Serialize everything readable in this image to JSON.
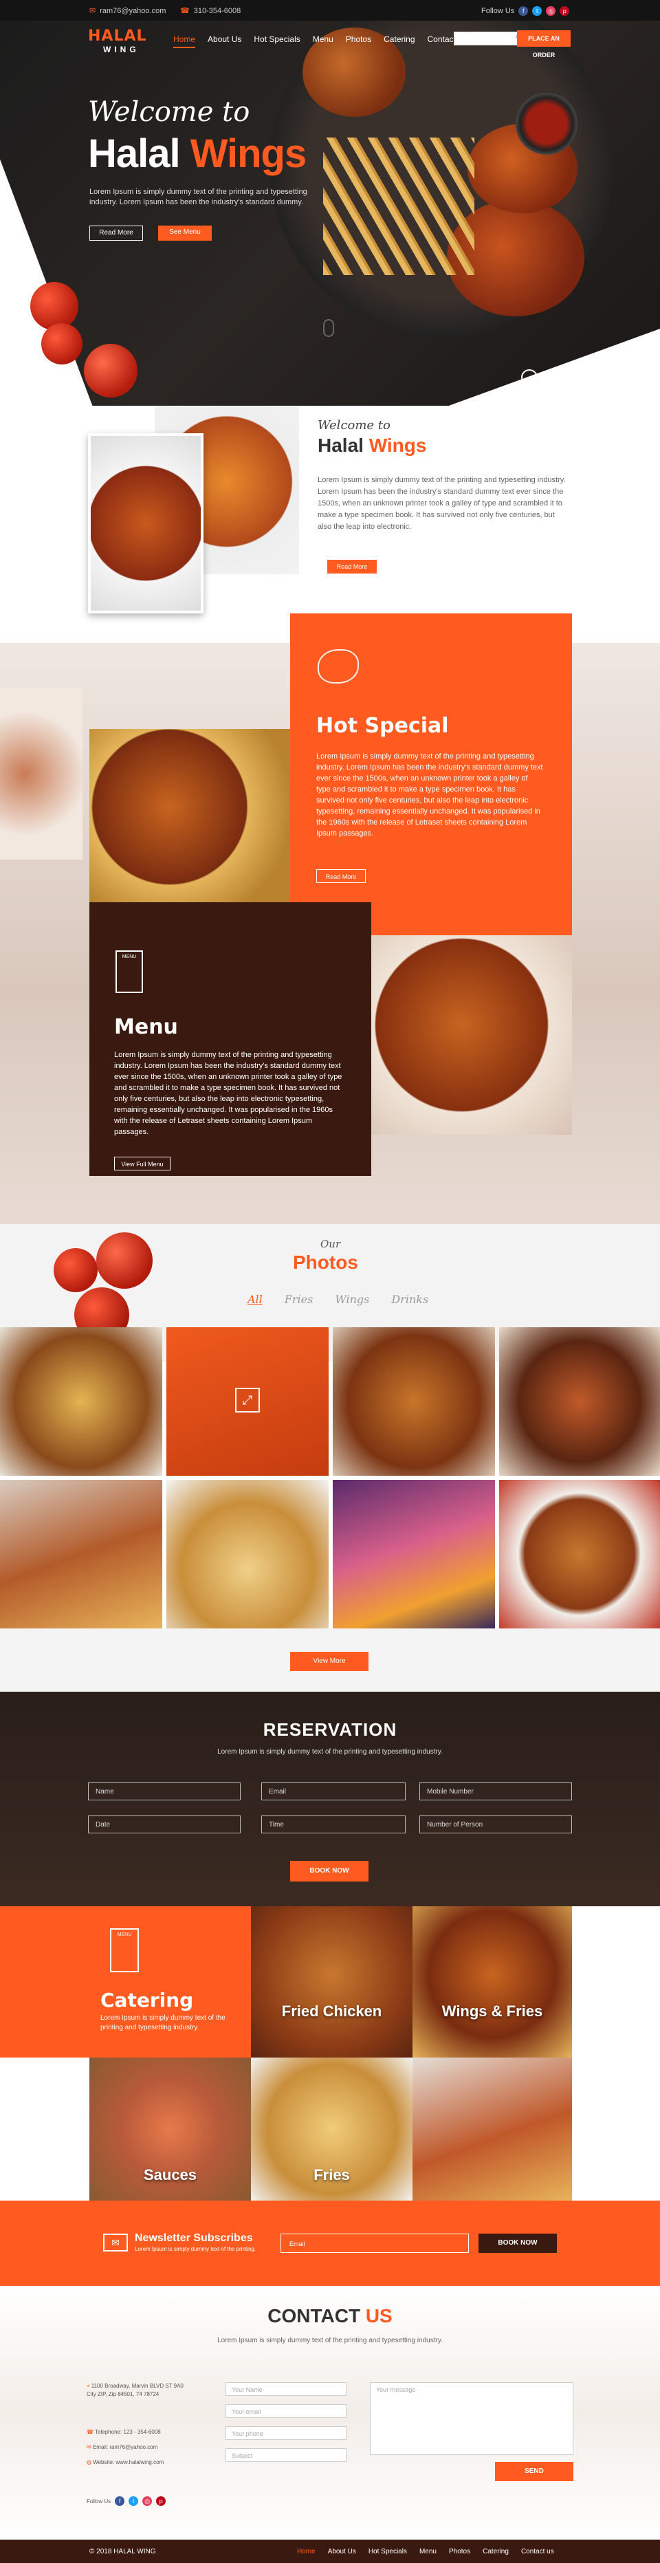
{
  "topbar": {
    "email": "ram76@yahoo.com",
    "phone": "310-354-6008",
    "follow_label": "Follow Us"
  },
  "brand": {
    "name_top": "HALAL",
    "name_bottom": "WING"
  },
  "nav": {
    "items": [
      "Home",
      "About Us",
      "Hot Specials",
      "Menu",
      "Photos",
      "Catering",
      "Contact Us"
    ],
    "order_button": "PLACE AN ORDER",
    "search_placeholder": ""
  },
  "hero": {
    "welcome": "Welcome to",
    "title_main": "Halal",
    "title_accent": "Wings",
    "text": "Lorem Ipsum is simply dummy text of the printing and typesetting industry. Lorem Ipsum has been the industry's standard dummy.",
    "read_more": "Read More",
    "see_menu": "See Menu",
    "prev": "‹",
    "next": "›"
  },
  "welcome": {
    "welcome": "Welcome to",
    "title_main": "Halal",
    "title_accent": "Wings",
    "text": "Lorem Ipsum is simply dummy text of the printing and typesetting industry. Lorem Ipsum has been the industry's standard dummy text ever since the 1500s, when an unknown printer took a galley of type and scrambled it to make a type specimen book. It has survived not only five centuries, but also the leap into electronic.",
    "read_more": "Read More"
  },
  "hot_special": {
    "title": "Hot Special",
    "text": "Lorem Ipsum is simply dummy text of the printing and typesetting industry. Lorem Ipsum has been the industry's standard dummy text ever since the 1500s, when an unknown printer took a galley of type and scrambled it to make a type specimen book. It has survived not only five centuries, but also the leap into electronic typesetting, remaining essentially unchanged. It was popularised in the 1960s with the release of Letraset sheets containing Lorem Ipsum passages.",
    "read_more": "Read More"
  },
  "menu": {
    "icon_label": "MENU",
    "title": "Menu",
    "text": "Lorem Ipsum is simply dummy text of the printing and typesetting industry. Lorem Ipsum has been the industry's standard dummy text ever since the 1500s, when an unknown printer took a galley of type and scrambled it to make a type specimen book. It has survived not only five centuries, but also the leap into electronic typesetting, remaining essentially unchanged. It was popularised in the 1960s with the release of Letraset sheets containing Lorem Ipsum passages.",
    "view_full": "View Full Menu"
  },
  "photos": {
    "our": "Our",
    "title": "Photos",
    "filters": [
      "All",
      "Fries",
      "Wings",
      "Drinks"
    ],
    "view_more": "View More"
  },
  "reservation": {
    "title": "RESERVATION",
    "subtitle": "Lorem Ipsum is simply dummy text of the printing and typesetting industry.",
    "fields": [
      "Name",
      "Email",
      "Mobile Number",
      "Date",
      "Time",
      "Number of Person"
    ],
    "book": "BOOK NOW"
  },
  "catering": {
    "icon_label": "MENU",
    "title": "Catering",
    "text": "Lorem Ipsum is simply dummy text of the printing and typesetting industry.",
    "tiles": [
      "Fried Chicken",
      "Wings & Fries",
      "Sauces",
      "Fries"
    ]
  },
  "newsletter": {
    "title": "Newsletter Subscribes",
    "subtitle": "Lorem Ipsum is simply dummy text of the printing.",
    "email_placeholder": "Email",
    "book": "BOOK NOW"
  },
  "contact": {
    "title_main": "CONTACT",
    "title_accent": "US",
    "subtitle": "Lorem Ipsum is simply dummy text of the printing and typesetting industry.",
    "address": "1100 Broadway, Marvin BLVD ST 9A0 City ZIP, Zip 84501, 74 78724",
    "phone": "Telephone: 123 - 354-6008",
    "email": "Email: ram76@yahoo.com",
    "website": "Website: www.halalwing.com",
    "follow": "Follow Us",
    "placeholders": [
      "Your Name",
      "Your email",
      "Your phone",
      "Subject",
      "Your message"
    ],
    "send": "SEND"
  },
  "footer": {
    "copyright": "© 2018 HALAL WING",
    "links": [
      "Home",
      "About Us",
      "Hot Specials",
      "Menu",
      "Photos",
      "Catering",
      "Contact us"
    ]
  },
  "colors": {
    "accent": "#ff5a1f",
    "dark": "#3a1a10"
  }
}
